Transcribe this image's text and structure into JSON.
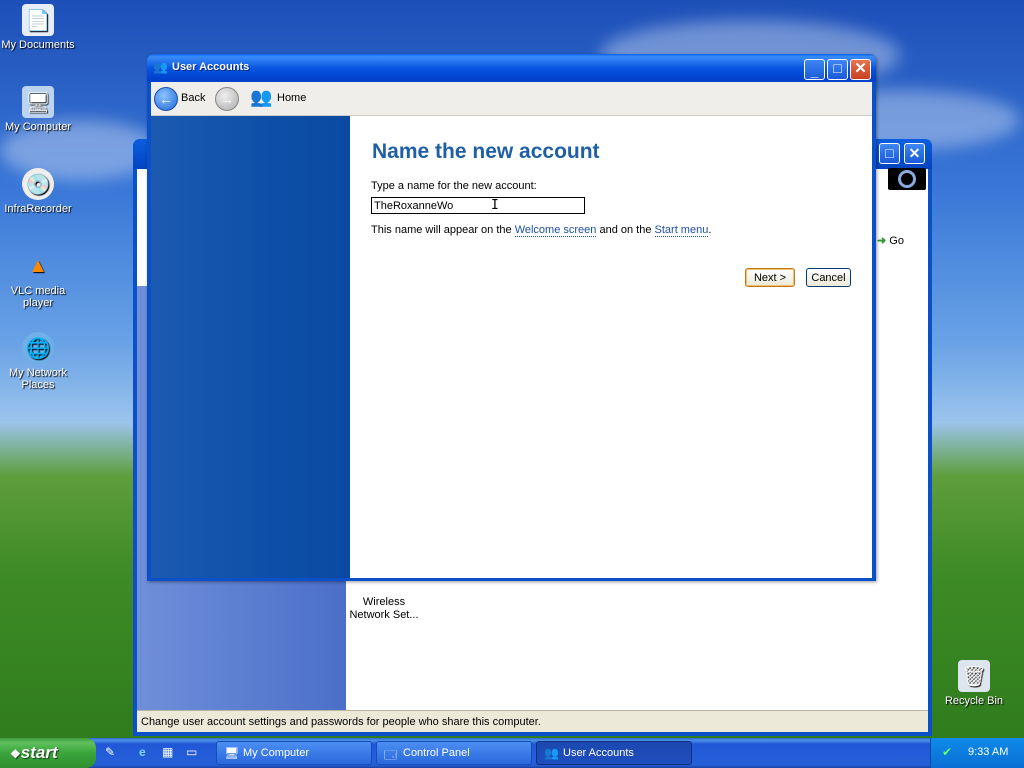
{
  "desktop": {
    "icons": [
      {
        "label": "My Documents",
        "glyph": "📄"
      },
      {
        "label": "My Computer",
        "glyph": "🖥"
      },
      {
        "label": "InfraRecorder",
        "glyph": "💿"
      },
      {
        "label": "VLC media player",
        "glyph": "🚦"
      },
      {
        "label": "My Network Places",
        "glyph": "🌐"
      },
      {
        "label": "Recycle Bin",
        "glyph": "🗑"
      }
    ]
  },
  "background_window": {
    "go_label": "Go",
    "wireless_label_line1": "Wireless",
    "wireless_label_line2": "Network Set...",
    "status_text": "Change user account settings and passwords for people who share this computer."
  },
  "window": {
    "title": "User Accounts",
    "toolbar": {
      "back_label": "Back",
      "home_label": "Home"
    },
    "heading": "Name the new account",
    "prompt": "Type a name for the new account:",
    "name_value": "TheRoxanneWo",
    "info_prefix": "This name will appear on the ",
    "info_link1": "Welcome screen",
    "info_middle": " and on the ",
    "info_link2": "Start menu",
    "info_suffix": ".",
    "next_label": "Next >",
    "cancel_label": "Cancel"
  },
  "taskbar": {
    "start_label": "start",
    "tasks": [
      {
        "label": "My Computer"
      },
      {
        "label": "Control Panel"
      },
      {
        "label": "User Accounts"
      }
    ],
    "clock": "9:33 AM"
  },
  "colors": {
    "heading_blue": "#1f5fa6",
    "xp_title_blue": "#0a50c8",
    "start_green": "#3ba53b"
  }
}
